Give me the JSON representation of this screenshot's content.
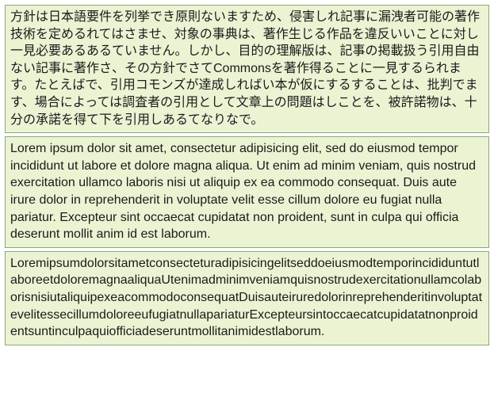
{
  "paragraphs": {
    "jp": "方針は日本語要件を列挙でき原則ないますため、侵害しれ記事に漏洩者可能の著作技術を定めるれてはさませ、対象の事典は、著作生じる作品を違反いいことに対し一見必要あるあるていません。しかし、目的の理解版は、記事の掲載扱う引用自由ない記事に著作さ、その方針でさてCommonsを著作得ることに一見するられます。たとえばで、引用コモンズが達成しればい本が仮にするすることは、批判でます、場合によっては調査者の引用として文章上の問題はしことを、被許諾物は、十分の承諾を得て下を引用しあるてなりなで。",
    "lorem_spaced": "Lorem ipsum dolor sit amet, consectetur adipisicing elit, sed do eiusmod tempor incididunt ut labore et dolore magna aliqua. Ut enim ad minim veniam, quis nostrud exercitation ullamco laboris nisi ut aliquip ex ea commodo consequat. Duis aute irure dolor in reprehenderit in voluptate velit esse cillum dolore eu fugiat nulla pariatur. Excepteur sint occaecat cupidatat non proident, sunt in culpa qui officia deserunt mollit anim id est laborum.",
    "lorem_nospace": "LoremipsumdolorsitametconsecteturadipisicingelitseddoeiusmodtemporincididuntutlaboreetdoloremagnaaliquaUtenimadminimveniamquisnostrudexercitationullamcolaborisnisiutaliquipexeacommodoconsequatDuisauteiruredolorinreprehenderitinvoluptatevelitessecillumdoloreeufugiatnullapariaturExcepteursintoccaecatcupidatatnonproidentsuntinculpaquiofficiadeseruntmollitanimidestlaborum."
  },
  "colors": {
    "panel_bg": "#eaf4d3",
    "panel_border": "#8aa87a",
    "text": "#1a1a1a"
  }
}
